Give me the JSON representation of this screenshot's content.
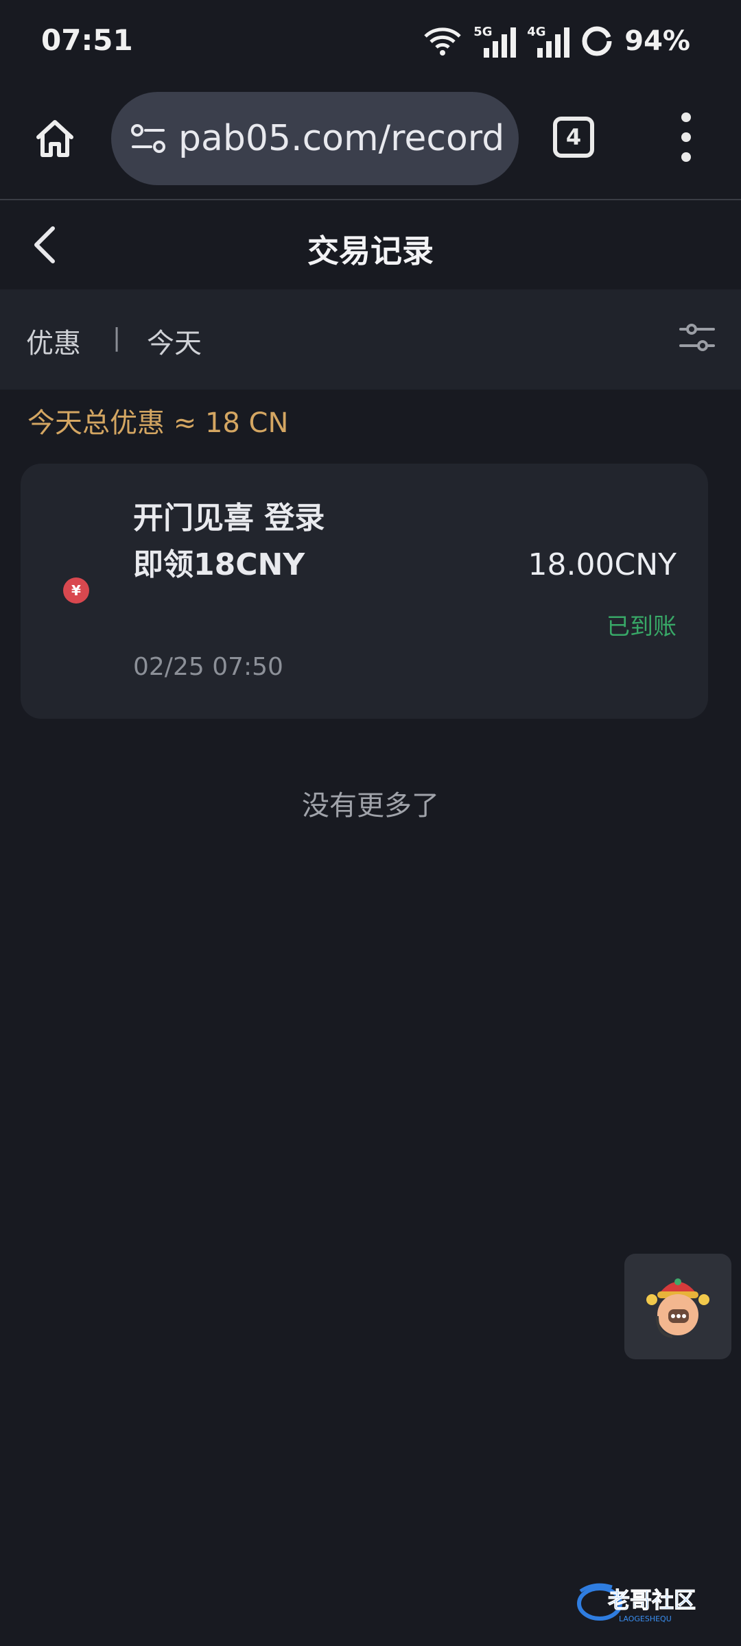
{
  "status_bar": {
    "time": "07:51",
    "signal1_tag": "5G",
    "signal2_tag": "4G",
    "battery": "94%",
    "icons": [
      "wifi-icon",
      "signal-5g-icon",
      "signal-4g-icon",
      "battery-ring-icon"
    ]
  },
  "browser": {
    "url": "pab05.com/record",
    "tab_count": "4",
    "icons": [
      "home-icon",
      "site-settings-icon",
      "tabs-icon",
      "more-vert-icon"
    ]
  },
  "page": {
    "title": "交易记录",
    "back_icon": "chevron-left-icon"
  },
  "filters": {
    "type": "优惠",
    "separator": "|",
    "date": "今天",
    "icon": "filter-sliders-icon"
  },
  "summary": {
    "text": "今天总优惠 ≈ 18 CN"
  },
  "records": [
    {
      "title": "开门见喜 登录即领18CNY",
      "date": "02/25 07:50",
      "amount": "18.00CNY",
      "status": "已到账",
      "icon": "yen-coin-icon"
    }
  ],
  "list_end": "没有更多了",
  "support": {
    "icon": "customer-service-avatar-icon"
  },
  "watermark": {
    "text": "老哥社区",
    "subtext": "LAOGESHEQU"
  },
  "colors": {
    "background": "#181a21",
    "card": "#22252d",
    "accent_gold": "#d4a662",
    "success_green": "#38a867",
    "yen_red": "#d9484f"
  }
}
